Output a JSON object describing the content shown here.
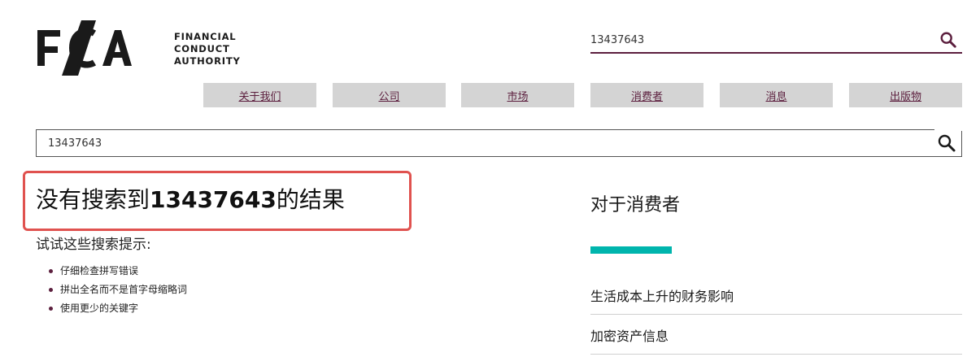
{
  "brand": {
    "logo_letters": "FCA",
    "name_lines": [
      "FINANCIAL",
      "CONDUCT",
      "AUTHORITY"
    ]
  },
  "header_search": {
    "value": "13437643",
    "icon": "search-icon"
  },
  "nav": {
    "items": [
      {
        "label": "关于我们"
      },
      {
        "label": "公司"
      },
      {
        "label": "市场"
      },
      {
        "label": "消费者"
      },
      {
        "label": "消息"
      },
      {
        "label": "出版物"
      }
    ]
  },
  "main_search": {
    "value": "13437643",
    "icon": "search-icon"
  },
  "results": {
    "heading_prefix": "没有搜索到",
    "query": "13437643",
    "heading_suffix": "的结果",
    "tips_title": "试试这些搜索提示:",
    "tips": [
      "仔细检查拼写错误",
      "拼出全名而不是首字母缩略词",
      "使用更少的关键字"
    ]
  },
  "sidebar": {
    "title": "对于消费者",
    "links": [
      {
        "label": "生活成本上升的财务影响"
      },
      {
        "label": "加密资产信息"
      }
    ]
  },
  "colors": {
    "brand_purple": "#5c1f3e",
    "accent_teal": "#00b5ad",
    "highlight_red": "#e0524f",
    "nav_grey": "#d4d4d4"
  }
}
